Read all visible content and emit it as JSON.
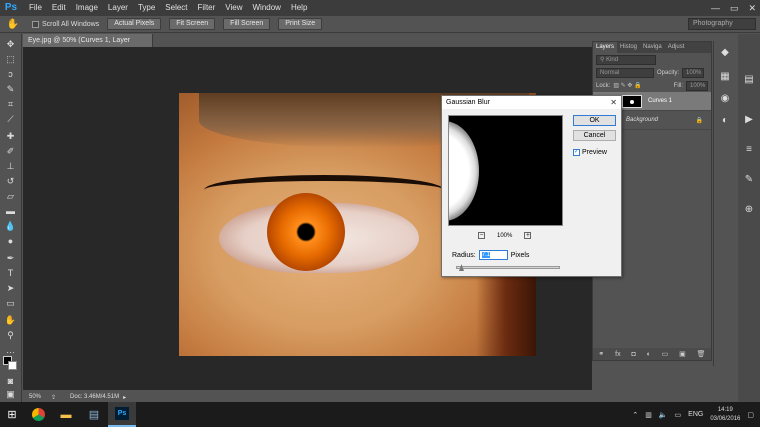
{
  "app": {
    "logo": "Ps",
    "accent": "#31a8ff"
  },
  "menu": [
    "File",
    "Edit",
    "Image",
    "Layer",
    "Type",
    "Select",
    "Filter",
    "View",
    "Window",
    "Help"
  ],
  "window_controls": [
    "—",
    "▭",
    "✕"
  ],
  "options_bar": {
    "hand_icon": "hand-icon",
    "scroll_all": "Scroll All Windows",
    "buttons": [
      "Actual Pixels",
      "Fit Screen",
      "Fill Screen",
      "Print Size"
    ],
    "workspace": "Photography"
  },
  "document": {
    "tab_title": "Eye.jpg @ 50% (Curves 1, Layer Mask/8) *",
    "zoom": "50%",
    "doc_info": "Doc: 3.46M/4.51M"
  },
  "layers_panel": {
    "tabs": [
      "Layers",
      "Histog",
      "Naviga",
      "Adjust"
    ],
    "kind_label": "Kind",
    "blend_mode": "Normal",
    "opacity_label": "Opacity:",
    "opacity_value": "100%",
    "lock_label": "Lock:",
    "fill_label": "Fill:",
    "fill_value": "100%",
    "layers": [
      {
        "name": "Curves 1",
        "selected": true
      },
      {
        "name": "Background",
        "selected": false
      }
    ],
    "footer_icons": [
      "link-icon",
      "fx-icon",
      "mask-icon",
      "adjustment-icon",
      "folder-icon",
      "new-layer-icon",
      "trash-icon"
    ]
  },
  "dialog": {
    "title": "Gaussian Blur",
    "ok": "OK",
    "cancel": "Cancel",
    "preview_label": "Preview",
    "preview_checked": true,
    "zoom": "100%",
    "radius_label": "Radius:",
    "radius_value": "7.1",
    "radius_unit": "Pixels"
  },
  "taskbar": {
    "apps": [
      "windows-start-icon",
      "chrome-icon",
      "file-explorer-icon",
      "notepad-icon",
      "photoshop-icon"
    ],
    "language": "ENG",
    "time": "14:19",
    "date": "03/06/2016"
  }
}
